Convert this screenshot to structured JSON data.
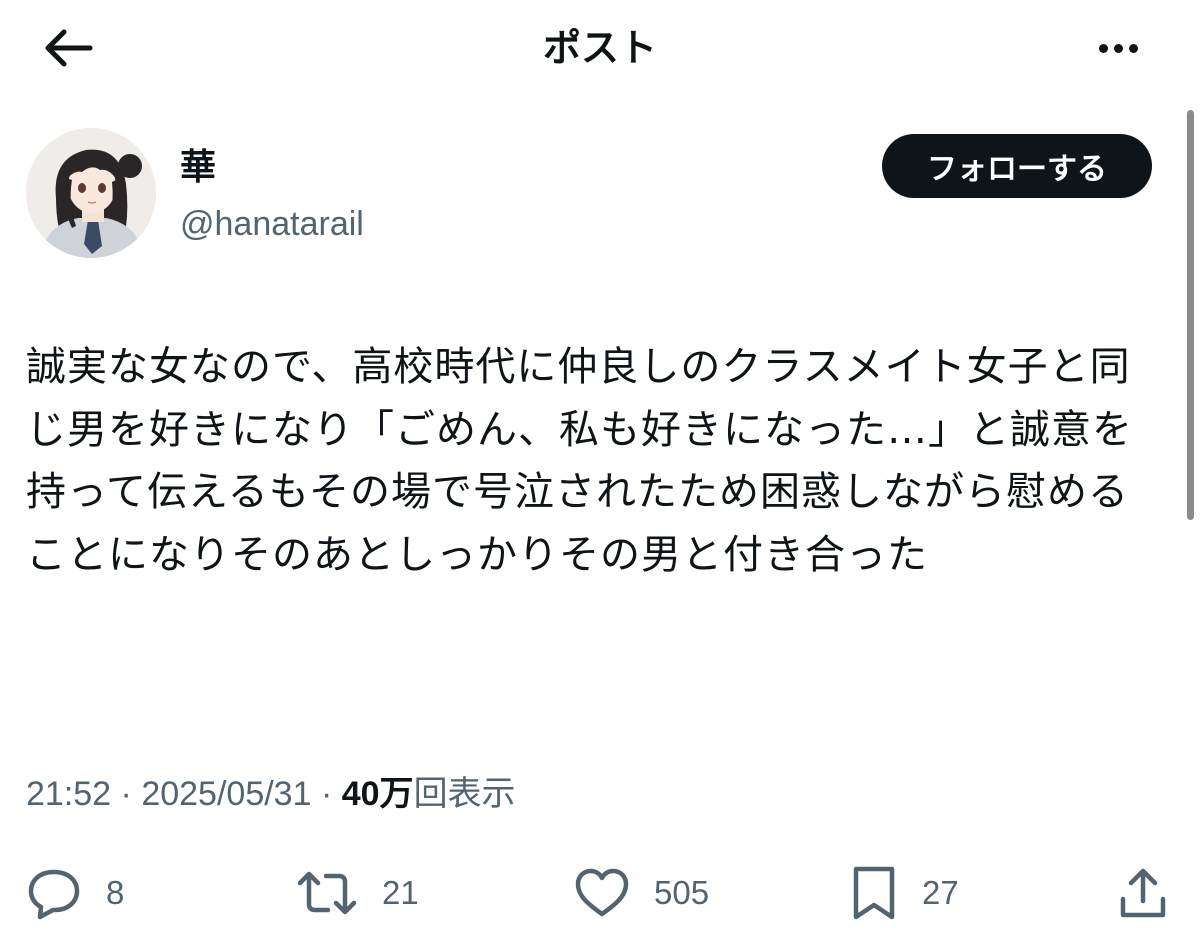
{
  "header": {
    "title": "ポスト"
  },
  "author": {
    "display_name": "華",
    "handle": "@hanatarail",
    "follow_label": "フォローする"
  },
  "post": {
    "text": "誠実な女なので、高校時代に仲良しのクラスメイト女子と同じ男を好きになり「ごめん、私も好きになった…」と誠意を持って伝えるもその場で号泣されたため困惑しながら慰めることになりそのあとしっかりその男と付き合った",
    "time": "21:52",
    "date": "2025/05/31",
    "separator": "·",
    "views_count": "40万",
    "views_label": "回表示"
  },
  "actions": {
    "replies": "8",
    "reposts": "21",
    "likes": "505",
    "bookmarks": "27"
  },
  "icons": {
    "back": "arrow-left-icon",
    "more": "more-horizontal-icon",
    "reply": "reply-bubble-icon",
    "repost": "repost-icon",
    "like": "heart-icon",
    "bookmark": "bookmark-icon",
    "share": "share-icon"
  },
  "colors": {
    "text": "#0f1419",
    "secondary": "#536471",
    "follow_bg": "#0f1419",
    "background": "#ffffff"
  }
}
